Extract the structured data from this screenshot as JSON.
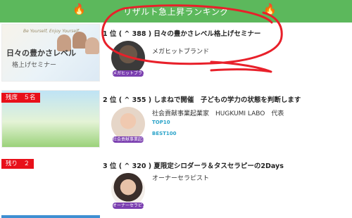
{
  "header": {
    "title": "リザルト急上昇ランキング"
  },
  "colors": {
    "header_bg": "#5cb85c",
    "badge_red": "#e8101a",
    "annotation_red": "#e8202a"
  },
  "items": [
    {
      "title": "1 位 ( ^ 388 ) 日々の豊かさレベル格上げセミナー",
      "subtitle": "メガヒットブランド",
      "badge": "",
      "thumb_text_top": "Be Yourself, Enjoy Yourself",
      "thumb_text_big": "日々の豊かさレベル",
      "thumb_text_big2": "格上げセミナー",
      "avatar_label": "メガヒットブランド"
    },
    {
      "title": "2 位 ( ^ 355 ) しまねで開催　子どもの学力の状態を判断します",
      "subtitle": "社会貢献事業起業家　HUGKUMI LABO　代表",
      "badge": "残席　５名",
      "awards": [
        "TOP10",
        "BEST100"
      ],
      "avatar_label": "社会貢献事業起業家"
    },
    {
      "title": "3 位 ( ^ 320 ) 夏限定シロダーラ＆タスセラピーの2Days",
      "subtitle": "オーナーセラピスト",
      "badge": "残り　２",
      "avatar_label": "オーナーセラピスト"
    }
  ]
}
